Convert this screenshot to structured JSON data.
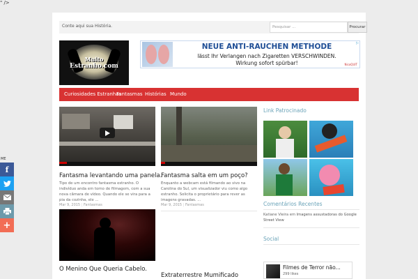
{
  "stray_text": "\" />",
  "topbar": {
    "tell_story": "Conte aqui sua História.",
    "search_placeholder": "Pesquisar ...",
    "search_button": "Procurar"
  },
  "logo": {
    "line1": "Muito",
    "line2": "Estranho.com"
  },
  "ad": {
    "headline": "NEUE ANTI-RAUCHEN METHODE",
    "line1": "lässt Ihr Verlangen nach Zigaretten VERSCHWINDEN.",
    "line2": "Wirkung sofort spürbar!",
    "brand": "NicoQUIT"
  },
  "nav": {
    "items": [
      {
        "label": "Curiosidades Estranhas"
      },
      {
        "label": "Fantasmas"
      },
      {
        "label": "Histórias"
      },
      {
        "label": "Mundo"
      }
    ]
  },
  "posts": [
    {
      "title": "Fantasma levantando uma panela.",
      "excerpt": "Tipo de um encontro fantasma estranho. O indivíduo anda em torno de filmagem, com a sua nova câmara de vídeo. Quando ele se vira para a pia da cozinha, ele ...",
      "date": "Mar 9, 2015",
      "category": "Fantasmas"
    },
    {
      "title": "Fantasma salta em um poço?",
      "excerpt": "Enquanto a webcam está filmando ao vivo na Carolina do Sul, um visualizador viu como algo estranho. Solicita o proprietário para rever as imagens gravadas. ...",
      "date": "Mar 9, 2015",
      "category": "Fantasmas"
    },
    {
      "title": "O Menino Que Queria Cabelo."
    },
    {
      "title": "Extraterrestre Mumificado"
    }
  ],
  "sidebar": {
    "sponsored_heading": "Link Patrocinado",
    "comments_heading": "Comentários Recentes",
    "comment_author": "Katiane Vieira",
    "comment_connector": "em",
    "comment_post": "Imagens assustadoras do Google Street View",
    "social_heading": "Social",
    "fb_page_name": "Filmes de Terror não...",
    "fb_likes": "299 likes"
  },
  "share": {
    "label": "ME",
    "colors": {
      "facebook": "#3b5998",
      "twitter": "#1da1f2",
      "email": "#777777",
      "print": "#6d9aab",
      "more": "#f26d55"
    }
  },
  "colors": {
    "accent": "#d83232",
    "heading": "#6aa3b8"
  }
}
